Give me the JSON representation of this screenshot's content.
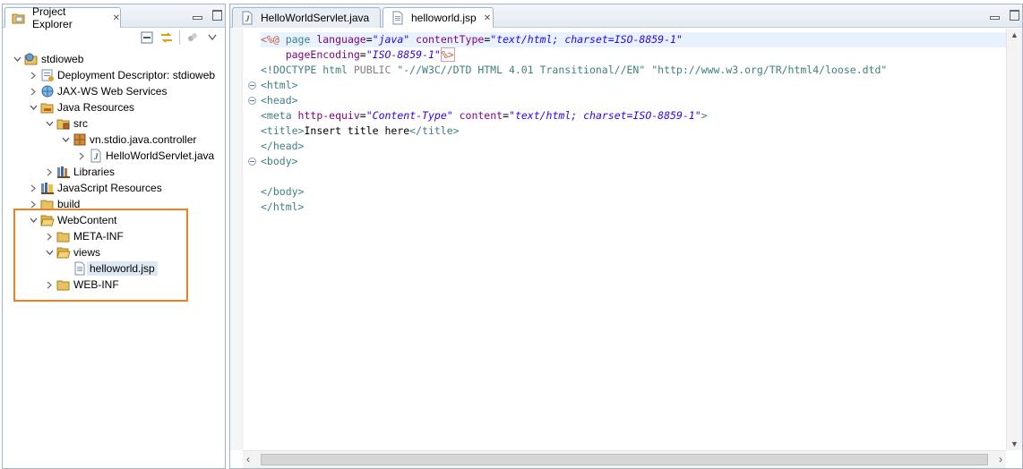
{
  "project_explorer": {
    "tab_label": "Project Explorer",
    "tree": [
      {
        "label": "stdioweb",
        "icon": "web-project-icon",
        "twisty": "open"
      },
      {
        "label": "Deployment Descriptor: stdioweb",
        "icon": "deployment-descriptor-icon",
        "twisty": "closed"
      },
      {
        "label": "JAX-WS Web Services",
        "icon": "web-services-icon",
        "twisty": "closed"
      },
      {
        "label": "Java Resources",
        "icon": "java-resources-icon",
        "twisty": "open"
      },
      {
        "label": "src",
        "icon": "source-folder-icon",
        "twisty": "open"
      },
      {
        "label": "vn.stdio.java.controller",
        "icon": "package-icon",
        "twisty": "open"
      },
      {
        "label": "HelloWorldServlet.java",
        "icon": "java-file-icon",
        "twisty": "closed"
      },
      {
        "label": "Libraries",
        "icon": "libraries-icon",
        "twisty": "closed"
      },
      {
        "label": "JavaScript Resources",
        "icon": "javascript-resources-icon",
        "twisty": "closed"
      },
      {
        "label": "build",
        "icon": "folder-icon",
        "twisty": "closed"
      },
      {
        "label": "WebContent",
        "icon": "folder-open-icon",
        "twisty": "open"
      },
      {
        "label": "META-INF",
        "icon": "folder-icon",
        "twisty": "closed"
      },
      {
        "label": "views",
        "icon": "folder-open-icon",
        "twisty": "open"
      },
      {
        "label": "helloworld.jsp",
        "icon": "jsp-file-icon",
        "twisty": "none",
        "selected": true
      },
      {
        "label": "WEB-INF",
        "icon": "folder-icon",
        "twisty": "closed"
      }
    ]
  },
  "editor": {
    "tabs": [
      {
        "label": "HelloWorldServlet.java",
        "icon": "java-file-icon",
        "active": false
      },
      {
        "label": "helloworld.jsp",
        "icon": "jsp-file-icon",
        "active": true
      }
    ],
    "code_lines": [
      [
        [
          "<%@ ",
          "jsp"
        ],
        [
          "page ",
          "delim"
        ],
        [
          "language",
          "attr"
        ],
        [
          "=",
          "text"
        ],
        [
          "\"java\"",
          "val"
        ],
        [
          " ",
          "text"
        ],
        [
          "contentType",
          "attr"
        ],
        [
          "=",
          "text"
        ],
        [
          "\"text/html; charset=ISO-8859-1\"",
          "val"
        ]
      ],
      [
        [
          "    ",
          "text"
        ],
        [
          "pageEncoding",
          "attr"
        ],
        [
          "=",
          "text"
        ],
        [
          "\"ISO-8859-1\"",
          "val"
        ],
        [
          "%>",
          "jspbox"
        ]
      ],
      [
        [
          "<!DOCTYPE html ",
          "doc"
        ],
        [
          "PUBLIC ",
          "pub"
        ],
        [
          "\"-//W3C//DTD HTML 4.01 Transitional//EN\"",
          "docstr"
        ],
        [
          " ",
          "text"
        ],
        [
          "\"http://www.w3.org/TR/html4/loose.dtd\"",
          "docstr"
        ]
      ],
      [
        [
          "<html>",
          "delim"
        ]
      ],
      [
        [
          "<head>",
          "delim"
        ]
      ],
      [
        [
          "<meta ",
          "delim"
        ],
        [
          "http-equiv",
          "attr"
        ],
        [
          "=",
          "text"
        ],
        [
          "\"Content-Type\"",
          "val"
        ],
        [
          " ",
          "text"
        ],
        [
          "content",
          "attr"
        ],
        [
          "=",
          "text"
        ],
        [
          "\"text/html; charset=ISO-8859-1\"",
          "val"
        ],
        [
          ">",
          "delim"
        ]
      ],
      [
        [
          "<title>",
          "delim"
        ],
        [
          "Insert title here",
          "text"
        ],
        [
          "</title>",
          "delim"
        ]
      ],
      [
        [
          "</head>",
          "delim"
        ]
      ],
      [
        [
          "<body>",
          "delim"
        ]
      ],
      [
        [
          "",
          "text"
        ]
      ],
      [
        [
          "</body>",
          "delim"
        ]
      ],
      [
        [
          "</html>",
          "delim"
        ]
      ]
    ]
  }
}
